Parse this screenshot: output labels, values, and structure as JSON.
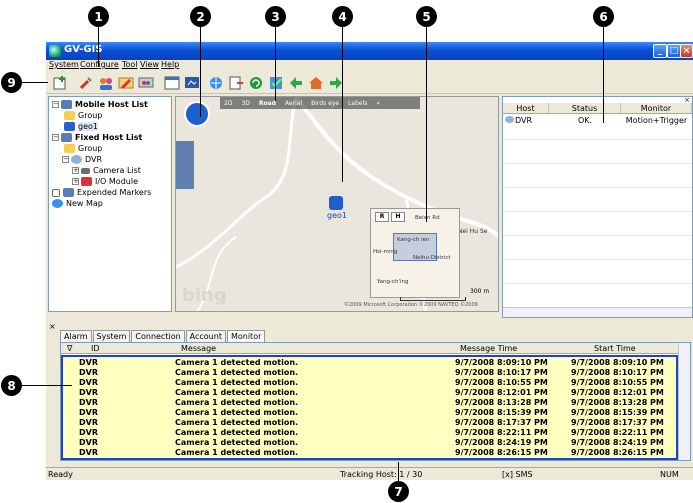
{
  "window": {
    "title": "GV-GIS"
  },
  "menu": [
    "System",
    "Configure",
    "Tool",
    "View",
    "Help"
  ],
  "toolbar_icons": [
    "add-icon",
    "tools-icon",
    "users-icon",
    "edit-icon",
    "monitor-icon",
    "window-icon",
    "display-icon",
    "globe-icon",
    "export-icon",
    "refresh-icon",
    "check-icon",
    "back-arrow-icon",
    "home-icon",
    "forward-arrow-icon"
  ],
  "tree": {
    "mobile_host_list": "Mobile Host List",
    "mobile_group": "Group",
    "geo1": "geo1",
    "fixed_host_list": "Fixed Host List",
    "fixed_group": "Group",
    "dvr": "DVR",
    "camera_list": "Camera List",
    "io_module": "I/O Module",
    "expended_markers": "Expended Markers",
    "new_map": "New Map"
  },
  "map": {
    "tabs": [
      "2D",
      "3D",
      "Road",
      "Aerial",
      "Birds eye",
      "Labels",
      "«"
    ],
    "vehicle_label": "geo1",
    "minimap_buttons": [
      "R",
      "H"
    ],
    "minimap_labels": [
      "Beian Rd",
      "Kang-ch ien",
      "Neihu District",
      "Hsi-ming",
      "Yang-ch'ing"
    ],
    "road_label": "Nei Hu Se",
    "scale": "300 m",
    "bing": "bing",
    "copyright": "©2009 Microsoft Corporation ©2009 NAVTEQ ©2009"
  },
  "host_panel": {
    "columns": [
      "Host",
      "Status",
      "Monitor"
    ],
    "rows": [
      {
        "host": "DVR",
        "status": "OK.",
        "monitor": "Motion+Trigger"
      }
    ]
  },
  "log_panel": {
    "tabs": [
      "Alarm",
      "System",
      "Connection",
      "Account",
      "Monitor"
    ],
    "active_tab": "Monitor",
    "columns": [
      "ID",
      "Message",
      "Message Time",
      "Start Time"
    ],
    "rows": [
      {
        "id": "DVR",
        "message": "Camera 1 detected motion.",
        "msg_time": "9/7/2008 8:09:10 PM",
        "start_time": "9/7/2008 8:09:10 PM"
      },
      {
        "id": "DVR",
        "message": "Camera 1 detected motion.",
        "msg_time": "9/7/2008 8:10:17 PM",
        "start_time": "9/7/2008 8:10:17 PM"
      },
      {
        "id": "DVR",
        "message": "Camera 1 detected motion.",
        "msg_time": "9/7/2008 8:10:55 PM",
        "start_time": "9/7/2008 8:10:55 PM"
      },
      {
        "id": "DVR",
        "message": "Camera 1 detected motion.",
        "msg_time": "9/7/2008 8:12:01 PM",
        "start_time": "9/7/2008 8:12:01 PM"
      },
      {
        "id": "DVR",
        "message": "Camera 1 detected motion.",
        "msg_time": "9/7/2008 8:13:28 PM",
        "start_time": "9/7/2008 8:13:28 PM"
      },
      {
        "id": "DVR",
        "message": "Camera 1 detected motion.",
        "msg_time": "9/7/2008 8:15:39 PM",
        "start_time": "9/7/2008 8:15:39 PM"
      },
      {
        "id": "DVR",
        "message": "Camera 1 detected motion.",
        "msg_time": "9/7/2008 8:17:37 PM",
        "start_time": "9/7/2008 8:17:37 PM"
      },
      {
        "id": "DVR",
        "message": "Camera 1 detected motion.",
        "msg_time": "9/7/2008 8:22:11 PM",
        "start_time": "9/7/2008 8:22:11 PM"
      },
      {
        "id": "DVR",
        "message": "Camera 1 detected motion.",
        "msg_time": "9/7/2008 8:24:19 PM",
        "start_time": "9/7/2008 8:24:19 PM"
      },
      {
        "id": "DVR",
        "message": "Camera 1 detected motion.",
        "msg_time": "9/7/2008 8:26:15 PM",
        "start_time": "9/7/2008 8:26:15 PM"
      }
    ]
  },
  "status_bar": {
    "ready": "Ready",
    "tracking": "Tracking Host: 1 / 30",
    "sms": "[x] SMS",
    "num": "NUM"
  },
  "callouts": [
    "1",
    "2",
    "3",
    "4",
    "5",
    "6",
    "7",
    "8",
    "9"
  ],
  "colors": {
    "selection_border": "#1e43c4",
    "row_highlight": "#ffffc0",
    "titlebar": "#0a4fd4"
  }
}
